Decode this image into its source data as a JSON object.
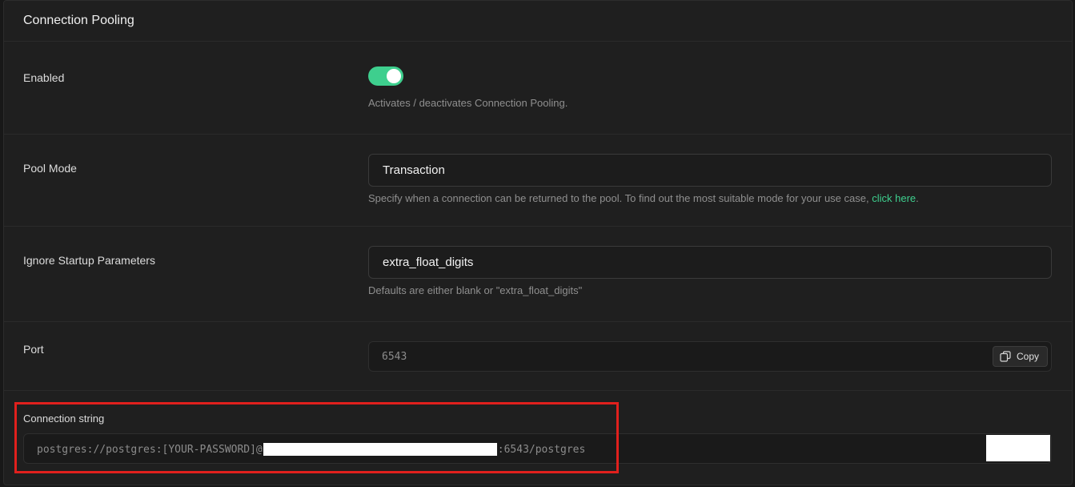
{
  "section": {
    "title": "Connection Pooling"
  },
  "enabled": {
    "label": "Enabled",
    "on": true,
    "description": "Activates / deactivates Connection Pooling."
  },
  "pool_mode": {
    "label": "Pool Mode",
    "value": "Transaction",
    "description": "Specify when a connection can be returned to the pool. To find out the most suitable mode for your use case,",
    "link_text": "click here",
    "link_suffix": "."
  },
  "ignore_startup": {
    "label": "Ignore Startup Parameters",
    "value": "extra_float_digits",
    "description": "Defaults are either blank or \"extra_float_digits\""
  },
  "port": {
    "label": "Port",
    "value": "6543",
    "copy_label": "Copy"
  },
  "connection_string": {
    "label": "Connection string",
    "prefix": "postgres://postgres:[YOUR-PASSWORD]@",
    "suffix": ":6543/postgres"
  },
  "colors": {
    "accent": "#3ecf8e",
    "highlight": "#e0201d",
    "background": "#1f1f1f"
  },
  "icons": {
    "copy": "copy-icon"
  }
}
